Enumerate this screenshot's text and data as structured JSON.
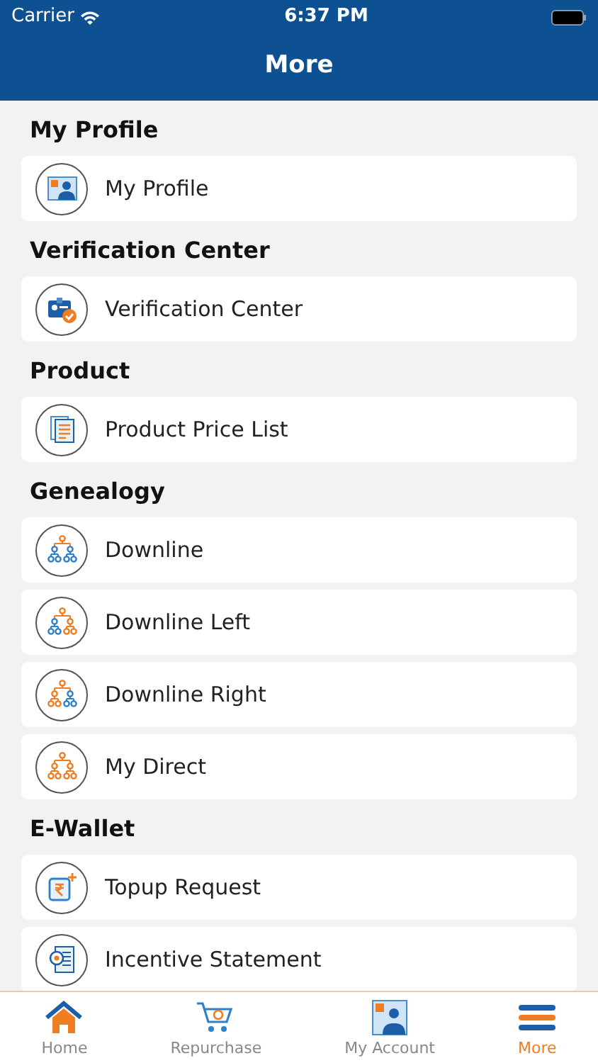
{
  "status_bar": {
    "carrier": "Carrier",
    "time": "6:37 PM"
  },
  "title": "More",
  "sections": [
    {
      "heading": "My Profile",
      "items": [
        {
          "label": "My Profile",
          "kind": "profile"
        }
      ]
    },
    {
      "heading": "Verification Center",
      "items": [
        {
          "label": "Verification Center",
          "kind": "verification"
        }
      ]
    },
    {
      "heading": "Product",
      "items": [
        {
          "label": "Product Price List",
          "kind": "pricelist"
        }
      ]
    },
    {
      "heading": "Genealogy",
      "items": [
        {
          "label": "Downline",
          "kind": "tree-all"
        },
        {
          "label": "Downline Left",
          "kind": "tree-left"
        },
        {
          "label": "Downline Right",
          "kind": "tree-right"
        },
        {
          "label": "My Direct",
          "kind": "tree-direct"
        }
      ]
    },
    {
      "heading": "E-Wallet",
      "items": [
        {
          "label": "Topup Request",
          "kind": "topup"
        },
        {
          "label": "Incentive Statement",
          "kind": "statement"
        }
      ]
    }
  ],
  "tabs": [
    {
      "label": "Home",
      "kind": "home",
      "selected": false
    },
    {
      "label": "Repurchase",
      "kind": "cart",
      "selected": false
    },
    {
      "label": "My Account",
      "kind": "account",
      "selected": false
    },
    {
      "label": "More",
      "kind": "more",
      "selected": true
    }
  ]
}
